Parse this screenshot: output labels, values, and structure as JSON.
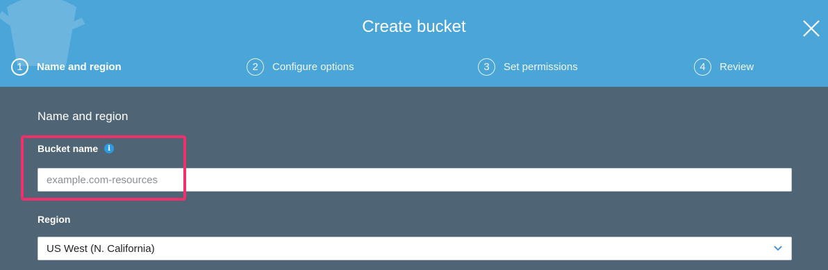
{
  "dialog": {
    "title": "Create bucket"
  },
  "steps": [
    {
      "number": "1",
      "label": "Name and region",
      "active": true
    },
    {
      "number": "2",
      "label": "Configure options",
      "active": false
    },
    {
      "number": "3",
      "label": "Set permissions",
      "active": false
    },
    {
      "number": "4",
      "label": "Review",
      "active": false
    }
  ],
  "form": {
    "section_title": "Name and region",
    "bucket_name": {
      "label": "Bucket name",
      "value": "",
      "placeholder": "example.com-resources"
    },
    "region": {
      "label": "Region",
      "selected": "US West (N. California)"
    }
  },
  "colors": {
    "header": "#4aa5d9",
    "body": "#4f6474",
    "highlight": "#f0306b",
    "info_icon": "#2e9be0"
  },
  "icons": [
    "close-icon",
    "info-icon",
    "chevron-down-icon"
  ]
}
